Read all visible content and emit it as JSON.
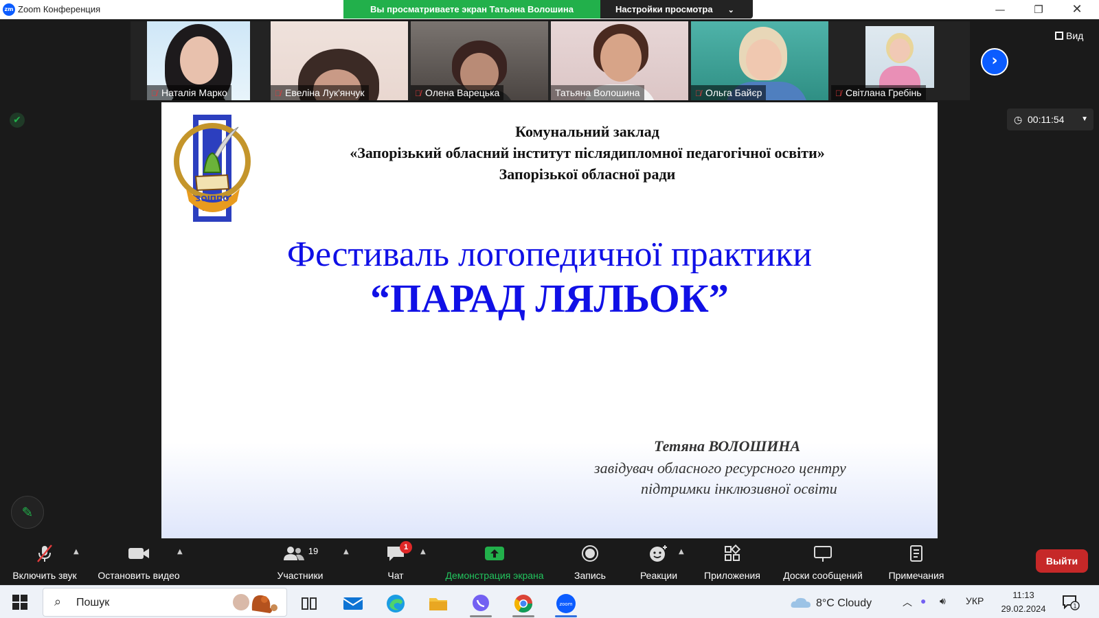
{
  "window": {
    "app_title": "Zoom Конференция",
    "logo_text": "zm"
  },
  "share_banner": {
    "viewing_text": "Вы просматриваете экран Татьяна Волошина",
    "settings_label": "Настройки просмотра"
  },
  "participants": [
    {
      "name": "Наталія Марко",
      "muted": true
    },
    {
      "name": "Евеліна Лук'янчук",
      "muted": true
    },
    {
      "name": "Олена Варецька",
      "muted": true
    },
    {
      "name": "Татьяна Волошина",
      "muted": false,
      "active_speaker": true
    },
    {
      "name": "Ольга Байєр",
      "muted": true
    },
    {
      "name": "Світлана Гребінь",
      "muted": true
    }
  ],
  "view_button_label": "Вид",
  "timer": "00:11:54",
  "slide": {
    "header_lines": [
      "Комунальний заклад",
      "«Запорізький обласний інститут післядипломної педагогічної освіти»",
      "Запорізької обласної ради"
    ],
    "logo_text": "ЗОІППО",
    "festival_title": "Фестиваль логопедичної практики",
    "festival_subtitle": "“ПАРАД ЛЯЛЬОК”",
    "author_name": "Тетяна ВОЛОШИНА",
    "author_role_line1": "завідувач обласного ресурсного центру",
    "author_role_line2": "підтримки інклюзивної освіти"
  },
  "toolbar": {
    "audio_label": "Включить звук",
    "video_label": "Остановить видео",
    "participants_label": "Участники",
    "participants_count": "19",
    "chat_label": "Чат",
    "chat_badge": "1",
    "share_label": "Демонстрация экрана",
    "record_label": "Запись",
    "reactions_label": "Реакции",
    "apps_label": "Приложения",
    "whiteboards_label": "Доски сообщений",
    "notes_label": "Примечания",
    "leave_label": "Выйти"
  },
  "taskbar": {
    "search_placeholder": "Пошук",
    "weather": "8°C  Cloudy",
    "language": "УКР",
    "time": "11:13",
    "date": "29.02.2024",
    "notification_count": "1"
  },
  "colors": {
    "zoom_blue": "#0b5cff",
    "share_green": "#22b04b",
    "leave_red": "#c62828",
    "slide_title_blue": "#1010e6"
  }
}
